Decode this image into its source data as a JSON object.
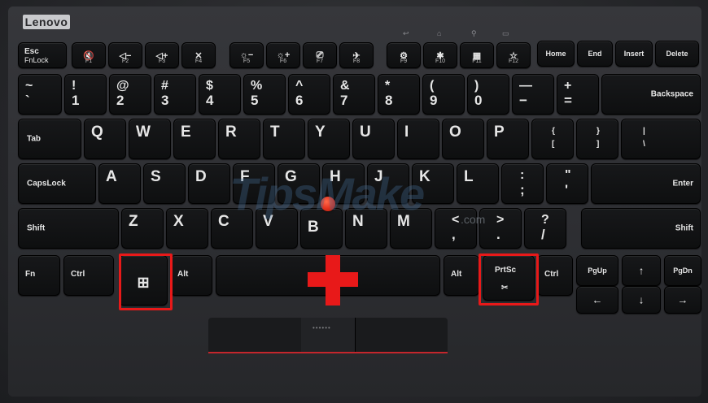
{
  "brand": "Lenovo",
  "watermark": {
    "main": "TipsMake",
    "suffix": ".com"
  },
  "colors": {
    "highlight": "#e81919",
    "trackpoint": "#e53420",
    "key": "#121314",
    "key_text": "#e6e6e6"
  },
  "fn_indicators": [
    "↩",
    "⌂",
    "⚲",
    "▭"
  ],
  "function_row": [
    {
      "top": "Esc",
      "bottom": "FnLock"
    },
    {
      "icon": "🔇",
      "label": "F1"
    },
    {
      "icon": "◁−",
      "label": "F2"
    },
    {
      "icon": "◁+",
      "label": "F3"
    },
    {
      "icon": "✕",
      "label": "F4"
    },
    {
      "icon": "☼−",
      "label": "F5"
    },
    {
      "icon": "☼+",
      "label": "F6"
    },
    {
      "icon": "⎚",
      "label": "F7"
    },
    {
      "icon": "✈",
      "label": "F8"
    },
    {
      "icon": "⚙",
      "label": "F9"
    },
    {
      "icon": "✱",
      "label": "F10"
    },
    {
      "icon": "▦",
      "label": "F11"
    },
    {
      "icon": "☆",
      "label": "F12"
    },
    {
      "label": "Home"
    },
    {
      "label": "End"
    },
    {
      "label": "Insert"
    },
    {
      "label": "Delete"
    }
  ],
  "number_row": [
    {
      "top": "~",
      "bottom": "`"
    },
    {
      "top": "!",
      "bottom": "1"
    },
    {
      "top": "@",
      "bottom": "2"
    },
    {
      "top": "#",
      "bottom": "3"
    },
    {
      "top": "$",
      "bottom": "4"
    },
    {
      "top": "%",
      "bottom": "5"
    },
    {
      "top": "^",
      "bottom": "6"
    },
    {
      "top": "&",
      "bottom": "7"
    },
    {
      "top": "*",
      "bottom": "8"
    },
    {
      "top": "(",
      "bottom": "9"
    },
    {
      "top": ")",
      "bottom": "0"
    },
    {
      "top": "—",
      "bottom": "−"
    },
    {
      "top": "+",
      "bottom": "="
    },
    {
      "label": "Backspace"
    }
  ],
  "top_row": [
    {
      "label": "Tab"
    },
    {
      "label": "Q"
    },
    {
      "label": "W"
    },
    {
      "label": "E"
    },
    {
      "label": "R"
    },
    {
      "label": "T"
    },
    {
      "label": "Y"
    },
    {
      "label": "U"
    },
    {
      "label": "I"
    },
    {
      "label": "O"
    },
    {
      "label": "P"
    },
    {
      "top": "{",
      "bottom": "["
    },
    {
      "top": "}",
      "bottom": "]"
    },
    {
      "top": "|",
      "bottom": "\\"
    }
  ],
  "home_row": [
    {
      "label": "CapsLock"
    },
    {
      "label": "A"
    },
    {
      "label": "S"
    },
    {
      "label": "D"
    },
    {
      "label": "F"
    },
    {
      "label": "G"
    },
    {
      "label": "H"
    },
    {
      "label": "J"
    },
    {
      "label": "K"
    },
    {
      "label": "L"
    },
    {
      "top": ":",
      "bottom": ";"
    },
    {
      "top": "\"",
      "bottom": "'"
    },
    {
      "label": "Enter"
    }
  ],
  "bottom_row": [
    {
      "label": "Shift"
    },
    {
      "label": "Z"
    },
    {
      "label": "X"
    },
    {
      "label": "C"
    },
    {
      "label": "V"
    },
    {
      "label": "B"
    },
    {
      "label": "N"
    },
    {
      "label": "M"
    },
    {
      "top": "<",
      "bottom": ","
    },
    {
      "top": ">",
      "bottom": "."
    },
    {
      "top": "?",
      "bottom": "/"
    },
    {
      "label": "Shift"
    }
  ],
  "space_row": [
    {
      "label": "Fn"
    },
    {
      "label": "Ctrl"
    },
    {
      "label": "⊞",
      "name": "windows"
    },
    {
      "label": "Alt"
    },
    {
      "label": ""
    },
    {
      "label": "Alt"
    },
    {
      "label": "PrtSc",
      "sub": "✂"
    },
    {
      "label": "Ctrl"
    },
    {
      "label": "PgUp"
    },
    {
      "label": "↑"
    },
    {
      "label": "PgDn"
    },
    {
      "label": "←"
    },
    {
      "label": "↓"
    },
    {
      "label": "→"
    }
  ],
  "annotation": {
    "plus": "+",
    "highlighted_keys": [
      "windows",
      "PrtSc"
    ]
  }
}
